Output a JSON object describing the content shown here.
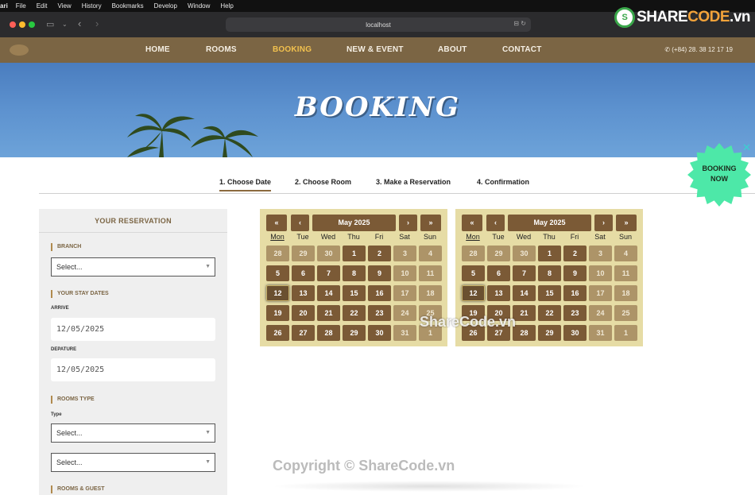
{
  "os_menu": [
    "ari",
    "File",
    "Edit",
    "View",
    "History",
    "Bookmarks",
    "Develop",
    "Window",
    "Help"
  ],
  "browser": {
    "url": "localhost"
  },
  "watermark_logo": {
    "text": "SHARECODE.vn",
    "letter": "S"
  },
  "nav": {
    "items": [
      "HOME",
      "ROOMS",
      "BOOKING",
      "NEW & EVENT",
      "ABOUT",
      "CONTACT"
    ],
    "active": "BOOKING",
    "phone": "(+84) 28. 38 12 17 19"
  },
  "hero": {
    "title": "BOOKING"
  },
  "badge": {
    "line1": "BOOKING",
    "line2": "NOW",
    "close": "✕"
  },
  "steps": [
    "1. Choose Date",
    "2. Choose Room",
    "3. Make a Reservation",
    "4. Confirmation"
  ],
  "sidebar": {
    "title": "YOUR RESERVATION",
    "branch_label": "BRANCH",
    "branch_value": "Select...",
    "stay_label": "YOUR STAY DATES",
    "arrive_label": "ARRIVE",
    "arrive_value": "12/05/2025",
    "depature_label": "DEPATURE",
    "depature_value": "12/05/2025",
    "rooms_type_label": "ROOMS TYPE",
    "type_label": "Type",
    "type_value": "Select...",
    "second_select_value": "Select...",
    "guest_label": "ROOMS & GUEST"
  },
  "calendar": {
    "month": "May 2025",
    "prev_year": "«",
    "prev": "‹",
    "next": "›",
    "next_year": "»",
    "weekdays": [
      "Mon",
      "Tue",
      "Wed",
      "Thu",
      "Fri",
      "Sat",
      "Sun"
    ],
    "weeks": [
      [
        "28",
        "29",
        "30",
        "1",
        "2",
        "3",
        "4"
      ],
      [
        "5",
        "6",
        "7",
        "8",
        "9",
        "10",
        "11"
      ],
      [
        "12",
        "13",
        "14",
        "15",
        "16",
        "17",
        "18"
      ],
      [
        "19",
        "20",
        "21",
        "22",
        "23",
        "24",
        "25"
      ],
      [
        "26",
        "27",
        "28",
        "29",
        "30",
        "31",
        "1"
      ]
    ]
  },
  "overlay": {
    "center": "ShareCode.vn",
    "copyright": "Copyright © ShareCode.vn"
  },
  "colors": {
    "nav_bg": "#7b6544",
    "accent": "#f2c14e",
    "day_bg": "#7b5a36",
    "calendar_bg": "#e6dca5",
    "badge": "#4de8a8"
  }
}
